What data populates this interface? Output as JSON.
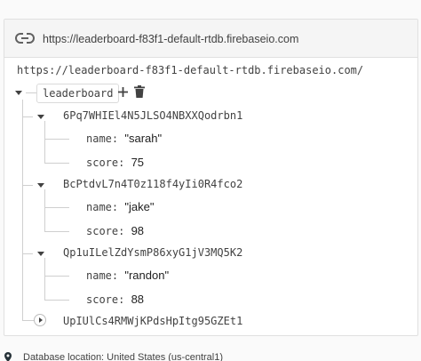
{
  "url_bar": {
    "url": "https://leaderboard-f83f1-default-rtdb.firebaseio.com"
  },
  "root_url": "https://leaderboard-f83f1-default-rtdb.firebaseio.com/",
  "root_node": {
    "key": "leaderboard"
  },
  "entries": [
    {
      "key": "6Pq7WHIEl4N5JLSO4NBXXQodrbn1",
      "expanded": true,
      "fields": [
        {
          "name": "name",
          "value": "\"sarah\""
        },
        {
          "name": "score",
          "value": "75"
        }
      ]
    },
    {
      "key": "BcPtdvL7n4T0z118f4yIi0R4fco2",
      "expanded": true,
      "fields": [
        {
          "name": "name",
          "value": "\"jake\""
        },
        {
          "name": "score",
          "value": "98"
        }
      ]
    },
    {
      "key": "Qp1uILelZdYsmP86xyG1jV3MQ5K2",
      "expanded": true,
      "fields": [
        {
          "name": "name",
          "value": "\"randon\""
        },
        {
          "name": "score",
          "value": "88"
        }
      ]
    },
    {
      "key": "UpIUlCs4RMWjKPdsHpItg95GZEt1",
      "expanded": false,
      "fields": []
    }
  ],
  "footer": {
    "text": "Database location: United States (us-central1)"
  },
  "icons": {
    "url": "link-icon",
    "add": "plus-icon",
    "delete": "trash-icon",
    "location": "map-pin-icon"
  }
}
